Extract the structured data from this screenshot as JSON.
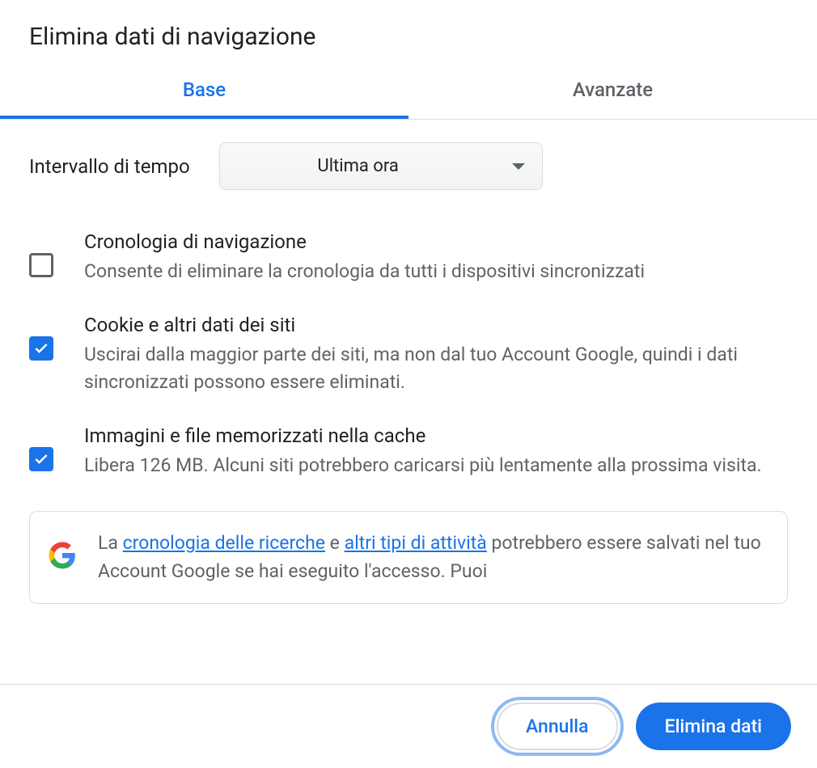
{
  "header": {
    "title": "Elimina dati di navigazione"
  },
  "tabs": {
    "base": "Base",
    "advanced": "Avanzate"
  },
  "time": {
    "label": "Intervallo di tempo",
    "selected": "Ultima ora"
  },
  "options": [
    {
      "key": "browsing-history",
      "checked": false,
      "title": "Cronologia di navigazione",
      "desc": "Consente di eliminare la cronologia da tutti i dispositivi sincronizzati"
    },
    {
      "key": "cookies",
      "checked": true,
      "title": "Cookie e altri dati dei siti",
      "desc": "Uscirai dalla maggior parte dei siti, ma non dal tuo Account Google, quindi i dati sincronizzati possono essere eliminati."
    },
    {
      "key": "cache",
      "checked": true,
      "title": "Immagini e file memorizzati nella cache",
      "desc": "Libera 126 MB. Alcuni siti potrebbero caricarsi più lentamente alla prossima visita."
    }
  ],
  "info": {
    "text_prefix": "La ",
    "link1": "cronologia delle ricerche",
    "text_mid": " e ",
    "link2": "altri tipi di attività",
    "text_suffix": " potrebbero essere salvati nel tuo Account Google se hai eseguito l'accesso. Puoi"
  },
  "footer": {
    "cancel": "Annulla",
    "confirm": "Elimina dati"
  }
}
